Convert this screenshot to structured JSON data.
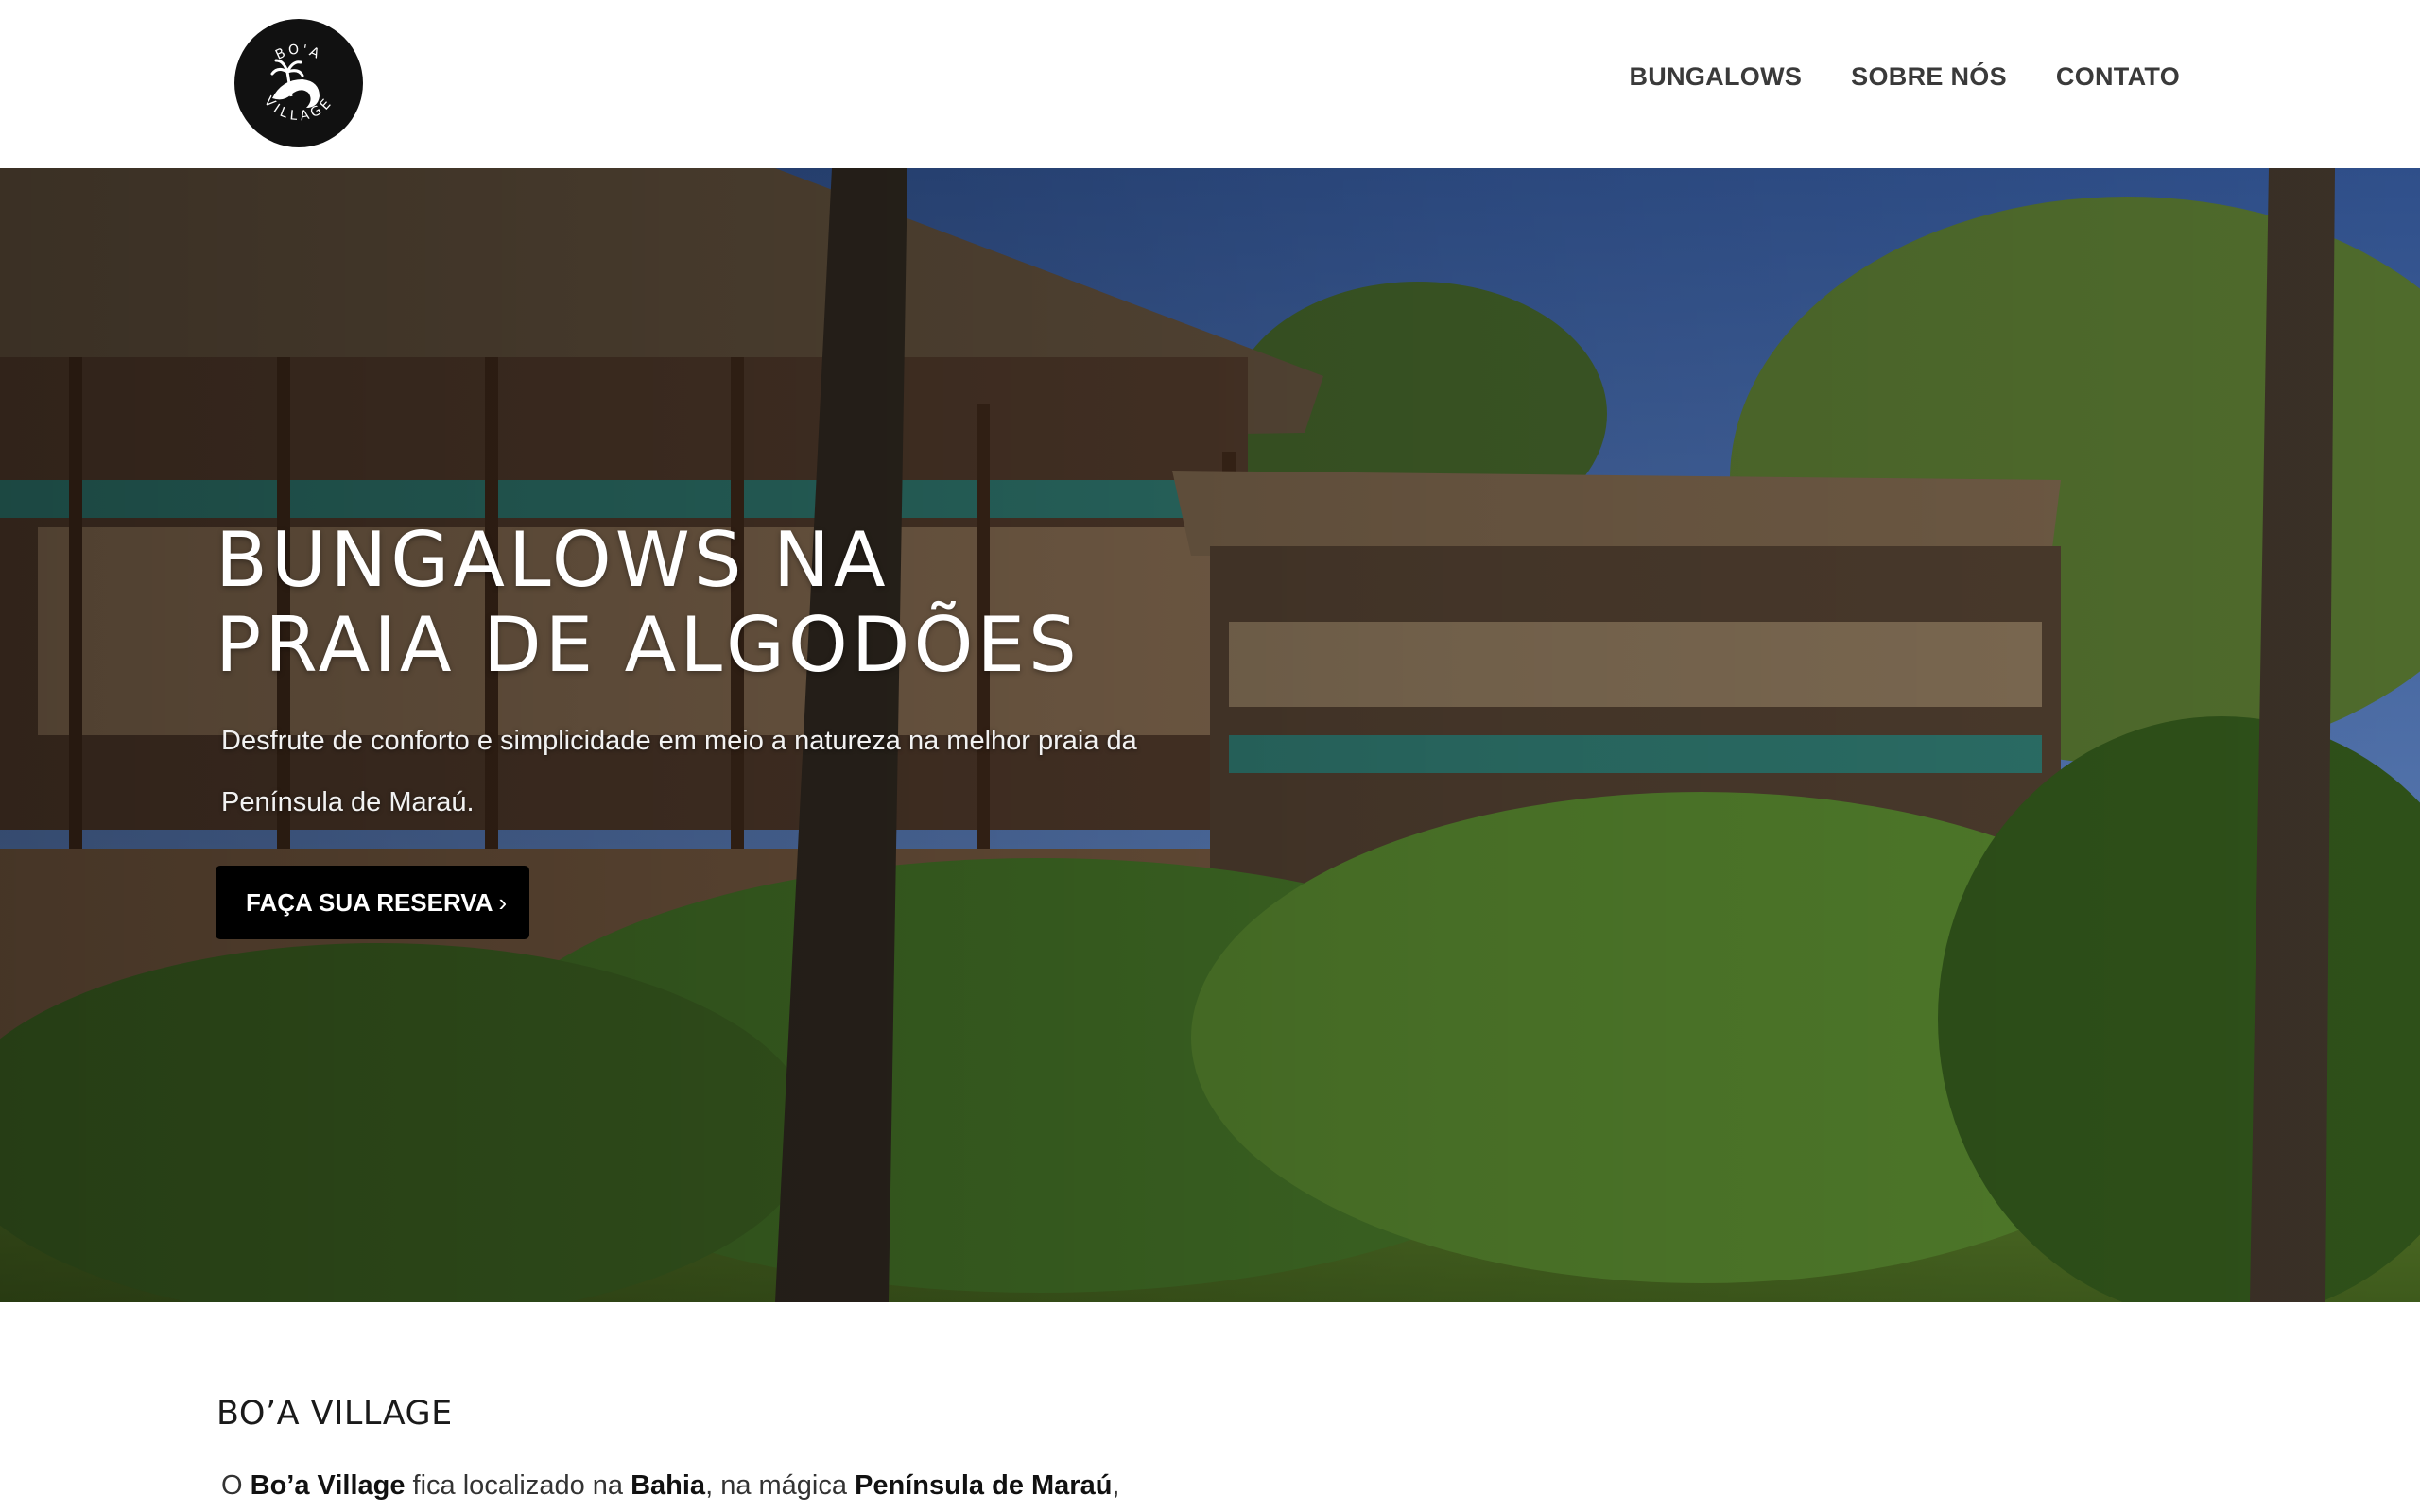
{
  "header": {
    "logo_text": "BO'A VILLAGE",
    "logo_icon": "palm-wave-logo",
    "nav": [
      {
        "label": "BUNGALOWS"
      },
      {
        "label": "SOBRE NÓS"
      },
      {
        "label": "CONTATO"
      }
    ]
  },
  "hero": {
    "title_line1": "BUNGALOWS NA",
    "title_line2": "PRAIA DE ALGODÕES",
    "subtitle": "Desfrute de conforto e simplicidade em meio a natureza na melhor praia da Península de Maraú.",
    "cta_label": "FAÇA SUA RESERVA",
    "cta_icon": "chevron-right-icon",
    "background": "tropical-bungalows-photo"
  },
  "intro": {
    "title": "BO’A VILLAGE",
    "text_parts": [
      "O ",
      "Bo’a Village",
      " fica localizado na ",
      "Bahia",
      ", na mágica ",
      "Península de Maraú",
      ","
    ]
  },
  "colors": {
    "header_bg": "#ffffff",
    "nav_text": "#3a3a3a",
    "cta_bg": "#000000",
    "cta_text": "#ffffff"
  }
}
